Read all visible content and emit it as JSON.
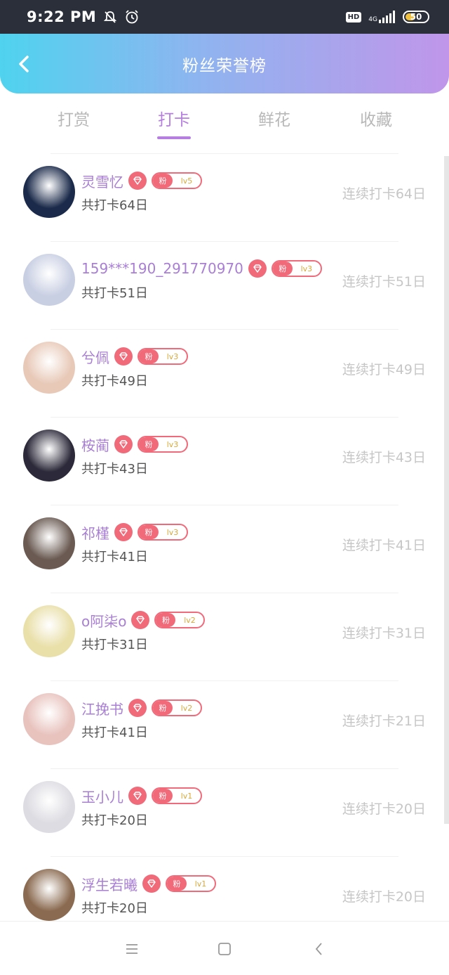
{
  "status_bar": {
    "time": "9:22 PM",
    "icons": [
      "mute-bell-icon",
      "alarm-icon",
      "hd-icon",
      "signal-icon",
      "battery-icon"
    ],
    "hd_label": "HD",
    "network_label": "4G",
    "battery_level": "50"
  },
  "header": {
    "title": "粉丝荣誉榜",
    "back_icon": "chevron-left-icon",
    "gradient": [
      "#4fd3ef",
      "#c096ea"
    ]
  },
  "tabs": [
    {
      "label": "打赏",
      "active": false
    },
    {
      "label": "打卡",
      "active": true
    },
    {
      "label": "鲜花",
      "active": false
    },
    {
      "label": "收藏",
      "active": false
    }
  ],
  "colors": {
    "accent": "#b57ee0",
    "name": "#a97fd4",
    "badge": "#f06a7a",
    "muted": "#c6c6c6"
  },
  "fans": [
    {
      "name": "灵雪忆",
      "fan_label": "粉",
      "level": "lv5",
      "total": "共打卡64日",
      "streak": "连续打卡64日",
      "avatar_color": "#1b2a4a"
    },
    {
      "name": "159***190_291770970",
      "fan_label": "粉",
      "level": "lv3",
      "total": "共打卡51日",
      "streak": "连续打卡51日",
      "avatar_color": "#c9cfe3"
    },
    {
      "name": "兮佩",
      "fan_label": "粉",
      "level": "lv3",
      "total": "共打卡49日",
      "streak": "连续打卡49日",
      "avatar_color": "#e8c9b8"
    },
    {
      "name": "桉蔺",
      "fan_label": "粉",
      "level": "lv3",
      "total": "共打卡43日",
      "streak": "连续打卡43日",
      "avatar_color": "#2c2a3a"
    },
    {
      "name": "祁槿",
      "fan_label": "粉",
      "level": "lv3",
      "total": "共打卡41日",
      "streak": "连续打卡41日",
      "avatar_color": "#6a5a52"
    },
    {
      "name": "o阿柒o",
      "fan_label": "粉",
      "level": "lv2",
      "total": "共打卡31日",
      "streak": "连续打卡31日",
      "avatar_color": "#e9dfa8"
    },
    {
      "name": "江挽书",
      "fan_label": "粉",
      "level": "lv2",
      "total": "共打卡41日",
      "streak": "连续打卡21日",
      "avatar_color": "#e8c2bd"
    },
    {
      "name": "玉小儿",
      "fan_label": "粉",
      "level": "lv1",
      "total": "共打卡20日",
      "streak": "连续打卡20日",
      "avatar_color": "#dcdce2"
    },
    {
      "name": "浮生若曦",
      "fan_label": "粉",
      "level": "lv1",
      "total": "共打卡20日",
      "streak": "连续打卡20日",
      "avatar_color": "#8a6a50"
    }
  ],
  "nav_bar": {
    "icons": [
      "menu-icon",
      "home-square-icon",
      "back-triangle-icon"
    ]
  }
}
